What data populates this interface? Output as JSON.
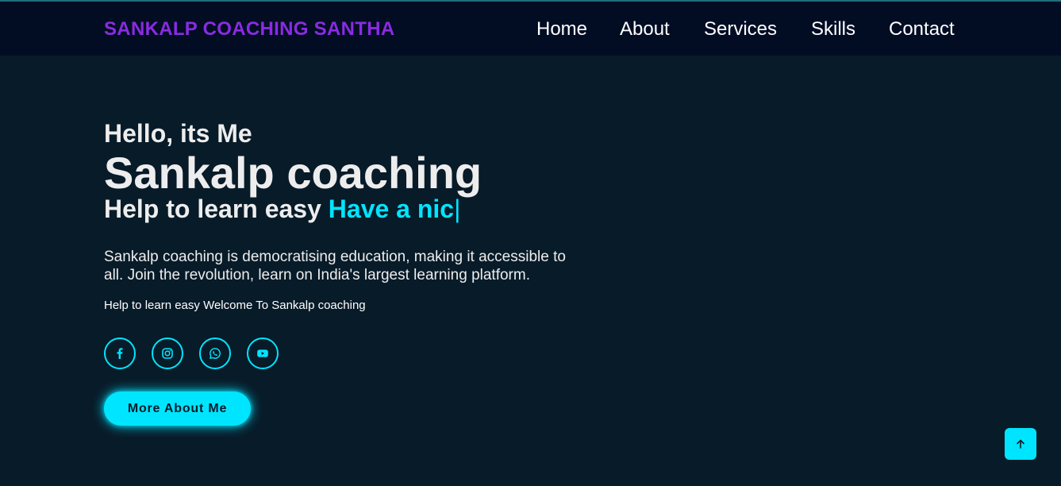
{
  "header": {
    "logo": "SANKALP COACHING SANTHA",
    "nav": [
      "Home",
      "About",
      "Services",
      "Skills",
      "Contact"
    ]
  },
  "hero": {
    "greeting": "Hello, its Me",
    "name": "Sankalp coaching",
    "tagline_static": "Help to learn easy",
    "tagline_typed": "Have a nic",
    "caret": "|",
    "description": "Sankalp coaching is democratising education, making it accessible to all. Join the revolution, learn on India's largest learning platform.",
    "subtext": "Help to learn easy Welcome To Sankalp coaching",
    "socials": [
      "facebook-icon",
      "instagram-icon",
      "whatsapp-icon",
      "youtube-icon"
    ],
    "button_label": "More About Me"
  },
  "scroll_top_icon": "arrow-up-icon",
  "colors": {
    "background": "#081b29",
    "header_background": "#020d24",
    "accent": "#00e5ff",
    "logo": "#8a2be2",
    "text": "#ededed"
  }
}
